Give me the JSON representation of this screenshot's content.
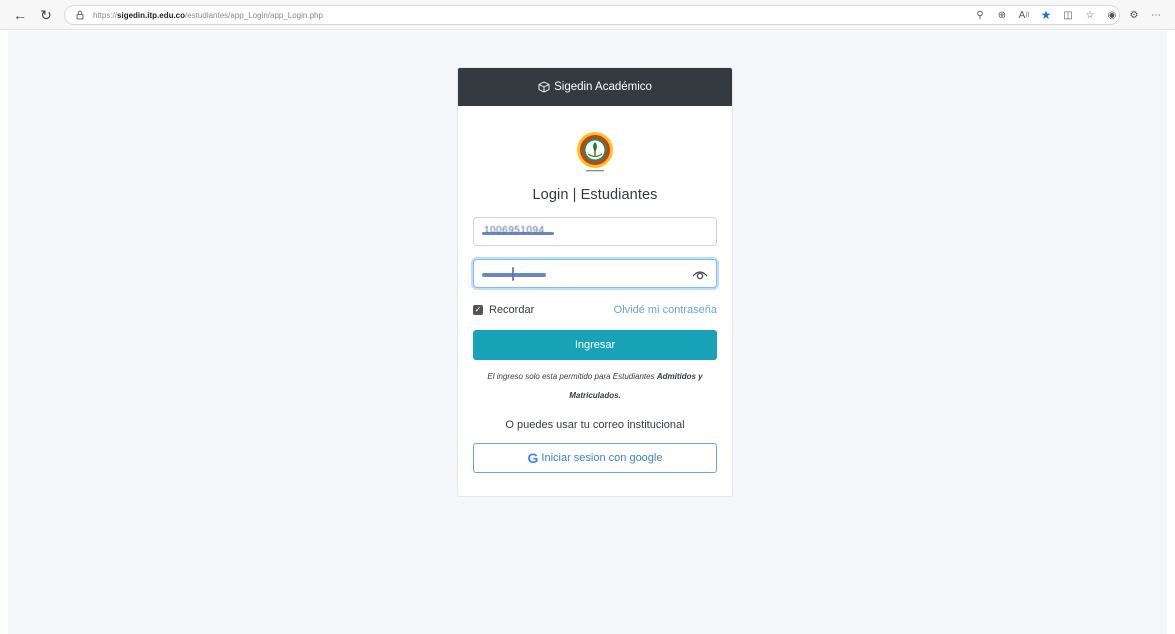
{
  "browser": {
    "url_prefix": "https://",
    "url_host": "sigedin.itp.edu.co",
    "url_path": "/estudiantes/app_Login/app_Login.php",
    "icons": [
      "back-arrow-icon",
      "reload-icon",
      "lock-icon",
      "search-page-icon",
      "zoom-icon",
      "read-aloud-icon",
      "favorite-star-icon",
      "split-screen-icon",
      "favorites-icon",
      "collections-icon",
      "extensions-icon",
      "more-icon"
    ]
  },
  "card": {
    "header_title": "Sigedin Académico",
    "login_title": "Login | Estudiantes",
    "username_value": "1006951094",
    "remember_label": "Recordar",
    "forgot_label": "Olvidé mi contraseña",
    "submit_label": "Ingresar",
    "note_prefix": "El ingreso solo esta permitido para Estudiantes ",
    "note_bold": "Admitidos y Matriculados.",
    "alt_text": "O puedes usar tu correo institucional",
    "google_g": "G",
    "google_label": "Iniciar sesion con google"
  },
  "colors": {
    "header_bg": "#343a40",
    "primary": "#17a2b8",
    "link": "#69a7d9",
    "page_bg": "#f4f6f9",
    "star": "#1a73e8"
  }
}
